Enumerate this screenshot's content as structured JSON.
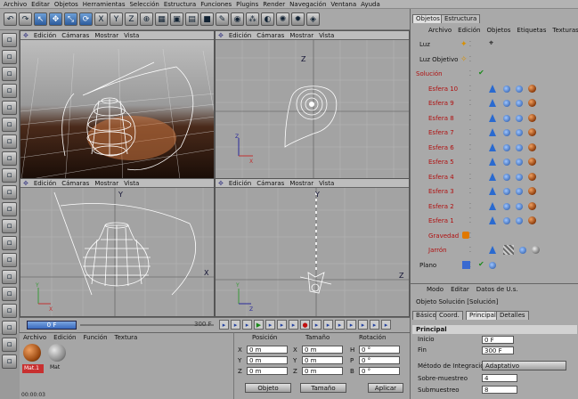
{
  "menu": [
    "Archivo",
    "Editar",
    "Objetos",
    "Herramientas",
    "Selección",
    "Estructura",
    "Funciones",
    "Plugins",
    "Render",
    "Navegación",
    "Ventana",
    "Ayuda"
  ],
  "toolbar_icons": [
    "undo-icon",
    "redo-icon",
    "pointer-icon",
    "move-icon",
    "scale-icon",
    "rotate-icon",
    "x-axis-icon",
    "y-axis-icon",
    "z-axis-icon",
    "coord-system-icon",
    "render-region-icon",
    "render-view-icon",
    "render-picture-icon",
    "cube-icon",
    "spline-pen-icon",
    "nurbs-icon",
    "array-icon",
    "deformer-icon",
    "scene-icon",
    "light-icon",
    "camera-icon"
  ],
  "viewport_menu": [
    "Edición",
    "Cámaras",
    "Mostrar",
    "Vista"
  ],
  "timeline": {
    "start": "0 F",
    "end": "300 F"
  },
  "material_menu": [
    "Archivo",
    "Edición",
    "Función",
    "Textura"
  ],
  "materials": [
    {
      "name": "Mat.1"
    },
    {
      "name": "Mat"
    }
  ],
  "coords": {
    "headers": [
      "Posición",
      "Tamaño",
      "Rotación"
    ],
    "rows": [
      {
        "a1": "X",
        "v1": "0 m",
        "a2": "X",
        "v2": "0 m",
        "a3": "H",
        "v3": "0 °"
      },
      {
        "a1": "Y",
        "v1": "0 m",
        "a2": "Y",
        "v2": "0 m",
        "a3": "P",
        "v3": "0 °"
      },
      {
        "a1": "Z",
        "v1": "0 m",
        "a2": "Z",
        "v2": "0 m",
        "a3": "B",
        "v3": "0 °"
      }
    ],
    "dropdown1": "Objeto",
    "dropdown2": "Tamaño",
    "apply": "Aplicar"
  },
  "objects": {
    "tabs": [
      "Objetos",
      "Estructura"
    ],
    "menu": [
      "Archivo",
      "Edición",
      "Objetos",
      "Etiquetas",
      "Texturas"
    ],
    "items": [
      {
        "name": "Luz",
        "color": "#111"
      },
      {
        "name": "Luz Objetivo",
        "color": "#111"
      },
      {
        "name": "Solución",
        "color": "#b01010"
      },
      {
        "name": "Esfera 10",
        "color": "#b01010"
      },
      {
        "name": "Esfera 9",
        "color": "#b01010"
      },
      {
        "name": "Esfera 8",
        "color": "#b01010"
      },
      {
        "name": "Esfera 7",
        "color": "#b01010"
      },
      {
        "name": "Esfera 6",
        "color": "#b01010"
      },
      {
        "name": "Esfera 5",
        "color": "#b01010"
      },
      {
        "name": "Esfera 4",
        "color": "#b01010"
      },
      {
        "name": "Esfera 3",
        "color": "#b01010"
      },
      {
        "name": "Esfera 2",
        "color": "#b01010"
      },
      {
        "name": "Esfera 1",
        "color": "#b01010"
      },
      {
        "name": "Gravedad",
        "color": "#b01010"
      },
      {
        "name": "Jarrón",
        "color": "#b01010"
      },
      {
        "name": "Plano",
        "color": "#111"
      }
    ]
  },
  "attributes": {
    "menu": [
      "Modo",
      "Editar",
      "Datos de U.s."
    ],
    "title": "Objeto Solución [Solución]",
    "tabs": [
      "Básico",
      "Coord.",
      "Principal",
      "Detalles"
    ],
    "section": "Principal",
    "fields": [
      {
        "label": "Inicio",
        "value": "0 F"
      },
      {
        "label": "Fin",
        "value": "300 F"
      }
    ],
    "method_label": "Método de Integración",
    "method_value": "Adaptativo",
    "over_label": "Sobre-muestreo",
    "over_value": "4",
    "sub_label": "Submuestreo",
    "sub_value": "8",
    "status_time": "00:00:03"
  }
}
